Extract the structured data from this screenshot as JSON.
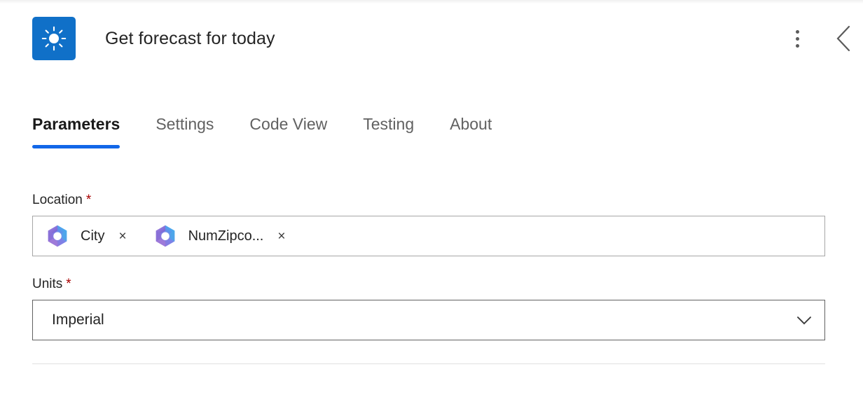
{
  "header": {
    "icon": "sun-icon",
    "icon_bg": "#1070c8",
    "title": "Get forecast for today",
    "more_options_label": "More options",
    "collapse_label": "Collapse"
  },
  "tabs": [
    {
      "label": "Parameters",
      "active": true
    },
    {
      "label": "Settings",
      "active": false
    },
    {
      "label": "Code View",
      "active": false
    },
    {
      "label": "Testing",
      "active": false
    },
    {
      "label": "About",
      "active": false
    }
  ],
  "accent_color": "#1267e8",
  "required_marker": "*",
  "required_color": "#a80000",
  "fields": {
    "location": {
      "label": "Location",
      "required": true,
      "tokens": [
        {
          "icon": "copilot-icon",
          "text": "City",
          "remove": "×"
        },
        {
          "icon": "copilot-icon",
          "text": "NumZipco...",
          "remove": "×"
        }
      ]
    },
    "units": {
      "label": "Units",
      "required": true,
      "value": "Imperial",
      "chevron": "chevron-down-icon"
    }
  }
}
